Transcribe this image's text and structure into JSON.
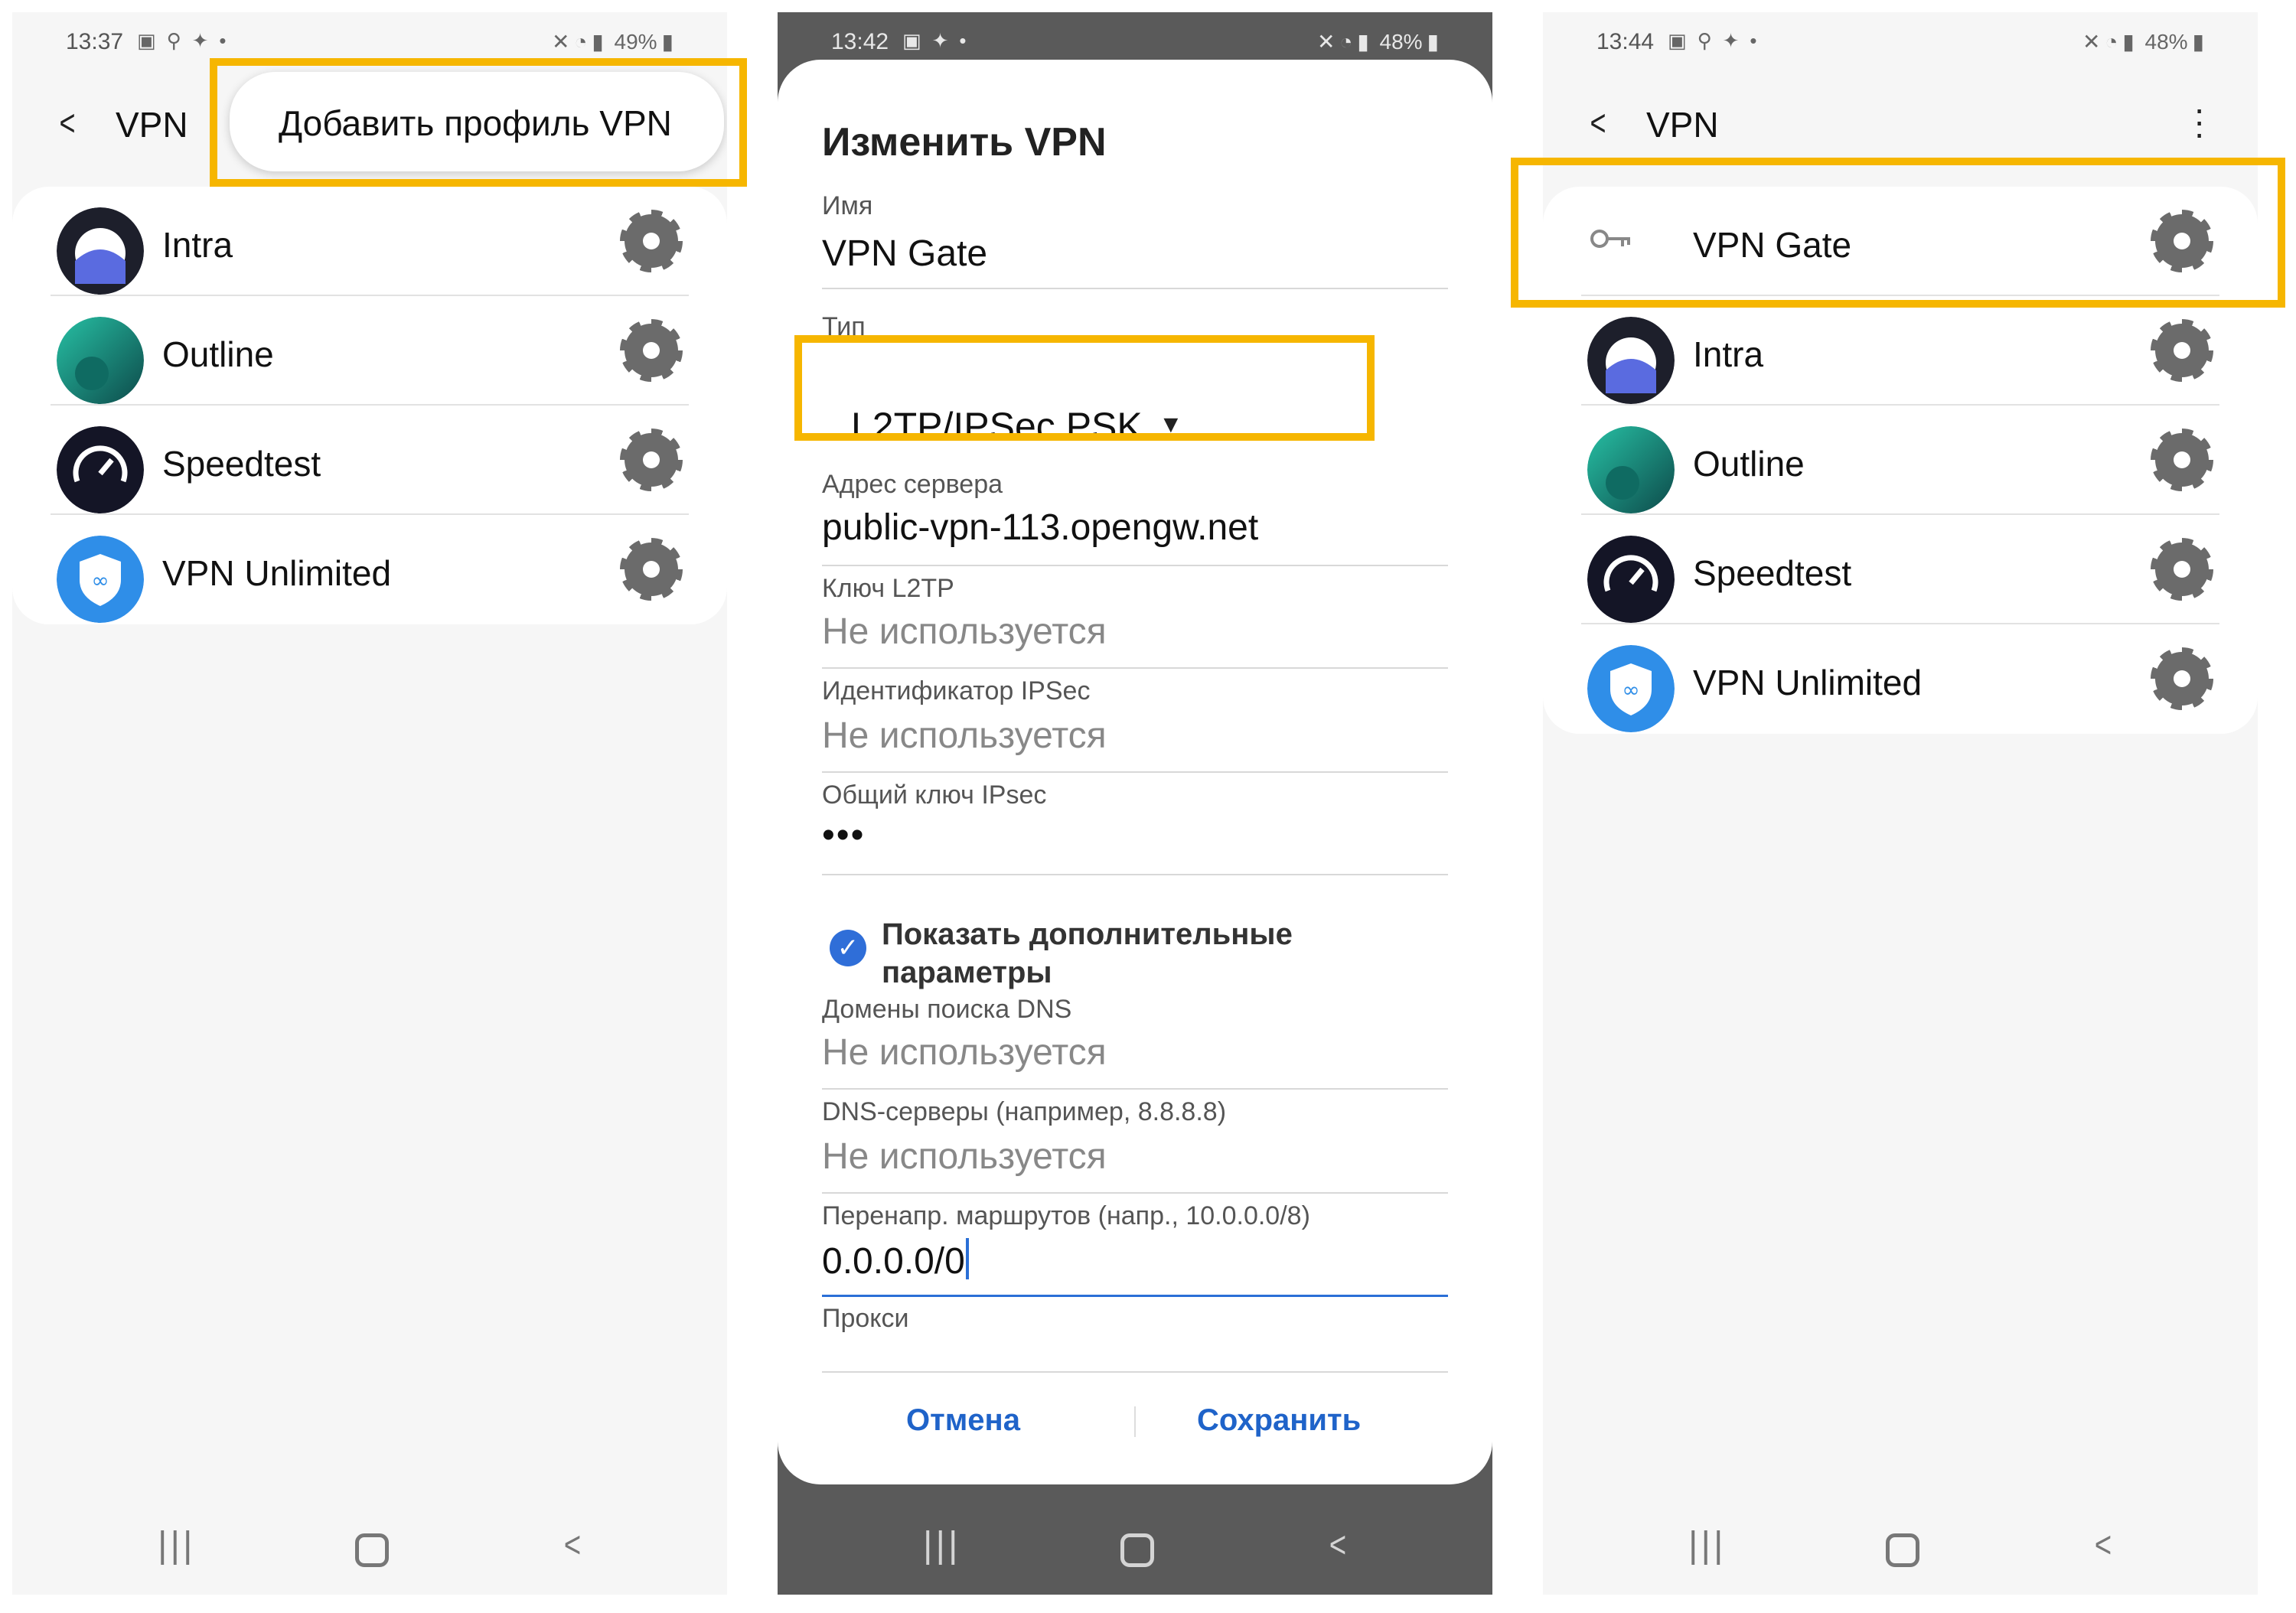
{
  "panel1": {
    "status": {
      "time": "13:37",
      "battery": "49%"
    },
    "title": "VPN",
    "popup_label": "Добавить профиль VPN",
    "items": [
      {
        "label": "Intra",
        "icon": "intra-app-icon"
      },
      {
        "label": "Outline",
        "icon": "outline-app-icon"
      },
      {
        "label": "Speedtest",
        "icon": "speedtest-app-icon"
      },
      {
        "label": "VPN Unlimited",
        "icon": "vpn-unlimited-app-icon"
      }
    ]
  },
  "panel2": {
    "status": {
      "time": "13:42",
      "battery": "48%"
    },
    "dialog_title": "Изменить VPN",
    "fields": {
      "name_label": "Имя",
      "name_value": "VPN Gate",
      "type_label": "Тип",
      "type_value": "L2TP/IPSec PSK",
      "server_label": "Адрес сервера",
      "server_value": "public-vpn-113.opengw.net",
      "l2tp_key_label": "Ключ L2TP",
      "l2tp_key_value": "Не используется",
      "ipsec_id_label": "Идентификатор IPSec",
      "ipsec_id_value": "Не используется",
      "ipsec_psk_label": "Общий ключ IPsec",
      "ipsec_psk_value": "•••",
      "show_advanced_label": "Показать дополнительные параметры",
      "dns_domains_label": "Домены поиска DNS",
      "dns_domains_value": "Не используется",
      "dns_servers_label": "DNS-серверы (например, 8.8.8.8)",
      "dns_servers_value": "Не используется",
      "routes_label": "Перенапр. маршрутов (напр., 10.0.0.0/8)",
      "routes_value": "0.0.0.0/0",
      "proxy_label": "Прокси"
    },
    "buttons": {
      "cancel": "Отмена",
      "save": "Сохранить"
    }
  },
  "panel3": {
    "status": {
      "time": "13:44",
      "battery": "48%"
    },
    "title": "VPN",
    "items": [
      {
        "label": "VPN Gate",
        "icon": "key-icon"
      },
      {
        "label": "Intra",
        "icon": "intra-app-icon"
      },
      {
        "label": "Outline",
        "icon": "outline-app-icon"
      },
      {
        "label": "Speedtest",
        "icon": "speedtest-app-icon"
      },
      {
        "label": "VPN Unlimited",
        "icon": "vpn-unlimited-app-icon"
      }
    ]
  },
  "colors": {
    "highlight": "#f6b600",
    "accent": "#1f63c9",
    "check": "#2f6ed8"
  }
}
